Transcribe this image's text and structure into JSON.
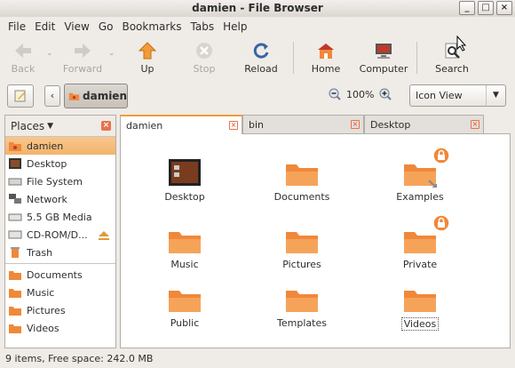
{
  "window": {
    "title": "damien - File Browser",
    "minimize": "_",
    "maximize": "□",
    "close": "×"
  },
  "menu": [
    "File",
    "Edit",
    "View",
    "Go",
    "Bookmarks",
    "Tabs",
    "Help"
  ],
  "toolbar": {
    "back": "Back",
    "forward": "Forward",
    "up": "Up",
    "stop": "Stop",
    "reload": "Reload",
    "home": "Home",
    "computer": "Computer",
    "search": "Search"
  },
  "location": {
    "crumb": "damien",
    "zoom": "100%",
    "view": "Icon View"
  },
  "sidebar": {
    "header": "Places",
    "places": [
      "damien",
      "Desktop",
      "File System",
      "Network",
      "5.5 GB Media",
      "CD-ROM/D...",
      "Trash"
    ],
    "bookmarks": [
      "Documents",
      "Music",
      "Pictures",
      "Videos"
    ]
  },
  "tabs": [
    "damien",
    "bin",
    "Desktop"
  ],
  "files": [
    "Desktop",
    "Documents",
    "Examples",
    "Music",
    "Pictures",
    "Private",
    "Public",
    "Templates",
    "Videos"
  ],
  "status": "9 items, Free space: 242.0 MB",
  "colors": {
    "accent": "#f29b3a",
    "folder": "#f0883a",
    "selection": "#f2b46c"
  }
}
